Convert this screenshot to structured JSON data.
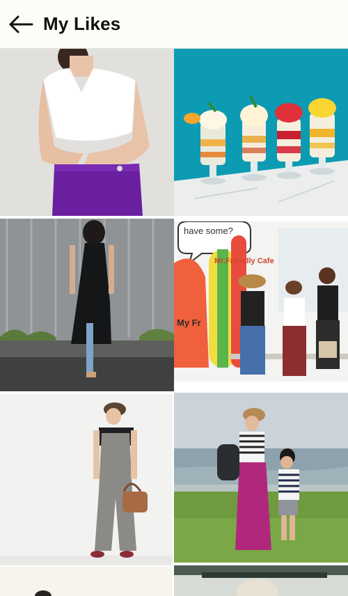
{
  "header": {
    "title": "My Likes",
    "back_icon": "arrow-left-icon"
  },
  "photos": [
    {
      "subject": "white-top-purple-skirt"
    },
    {
      "subject": "fruit-parfaits"
    },
    {
      "subject": "black-dress-outfit"
    },
    {
      "subject": "friends-cafe-wall",
      "mural_text_1": "have some?",
      "mural_text_2": "Mr.Friendly Cafe",
      "mural_text_3": "My Fr"
    },
    {
      "subject": "gray-jumpsuit-outfit"
    },
    {
      "subject": "mother-son-seaside"
    },
    {
      "subject": "partial-photo-left"
    },
    {
      "subject": "partial-photo-right"
    }
  ],
  "colors": {
    "appbar_bg": "#fbfdf7",
    "title_text": "#111111",
    "grid_gap": "#ffffff"
  }
}
